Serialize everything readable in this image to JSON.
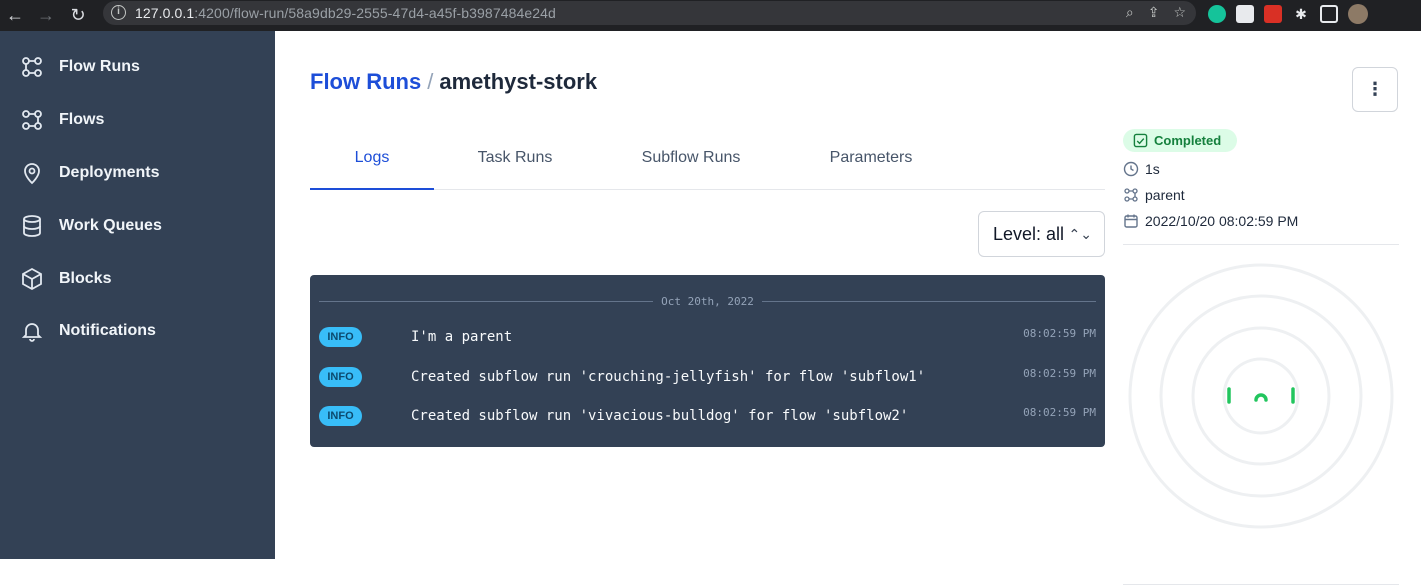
{
  "browser": {
    "url_host": "127.0.0.1",
    "url_path": ":4200/flow-run/58a9db29-2555-47d4-a45f-b3987484e24d"
  },
  "sidebar": {
    "items": [
      {
        "label": "Flow Runs",
        "icon": "flow-runs-icon"
      },
      {
        "label": "Flows",
        "icon": "flows-icon"
      },
      {
        "label": "Deployments",
        "icon": "location-pin-icon"
      },
      {
        "label": "Work Queues",
        "icon": "database-icon"
      },
      {
        "label": "Blocks",
        "icon": "cube-icon"
      },
      {
        "label": "Notifications",
        "icon": "bell-icon"
      }
    ]
  },
  "header": {
    "breadcrumb_link": "Flow Runs",
    "separator": "/",
    "run_name": "amethyst-stork",
    "menu_icon": "kebab-menu-icon"
  },
  "tabs": [
    {
      "label": "Logs",
      "active": true
    },
    {
      "label": "Task Runs",
      "active": false
    },
    {
      "label": "Subflow Runs",
      "active": false
    },
    {
      "label": "Parameters",
      "active": false
    }
  ],
  "level_filter": {
    "label": "Level: all"
  },
  "logs": {
    "date": "Oct 20th, 2022",
    "entries": [
      {
        "level": "INFO",
        "message": "I'm a parent",
        "time": "08:02:59 PM"
      },
      {
        "level": "INFO",
        "message": "Created subflow run 'crouching-jellyfish' for flow 'subflow1'",
        "time": "08:02:59 PM"
      },
      {
        "level": "INFO",
        "message": "Created subflow run 'vivacious-bulldog' for flow 'subflow2'",
        "time": "08:02:59 PM"
      }
    ]
  },
  "details": {
    "state": "Completed",
    "duration": "1s",
    "flow": "parent",
    "start_time": "2022/10/20 08:02:59 PM"
  },
  "colors": {
    "sidebar_bg": "#334155",
    "accent": "#1d4ed8",
    "completed_bg": "#dcfce7",
    "completed_text": "#15803d",
    "info_badge": "#38bdf8",
    "radar_node": "#22c55e"
  }
}
